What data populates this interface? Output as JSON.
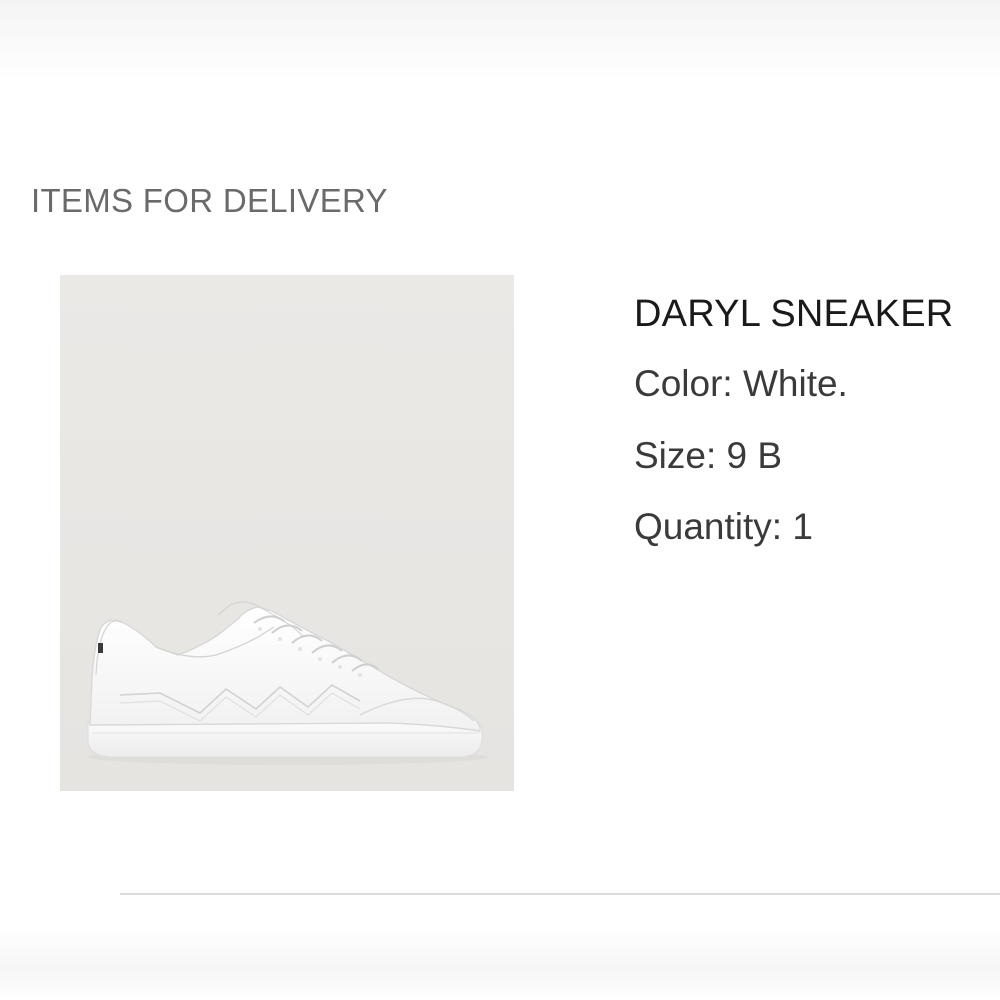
{
  "delivery": {
    "heading": "ITEMS FOR DELIVERY",
    "item": {
      "name": "DARYL SNEAKER",
      "color": "Color: White.",
      "size": "Size: 9 B",
      "quantity": "Quantity: 1",
      "image_icon": "white-sneaker-image",
      "image_background": "#e9e7e4"
    }
  }
}
